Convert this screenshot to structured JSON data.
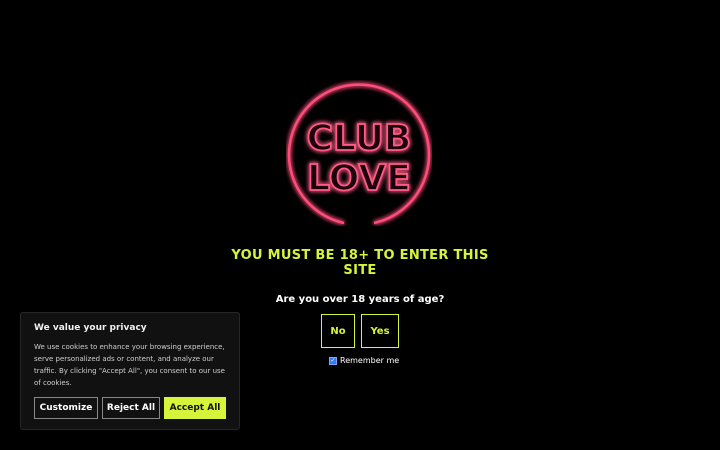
{
  "logo": {
    "line1": "CLUB",
    "line2": "LOVE"
  },
  "gate": {
    "headline": "YOU MUST BE 18+ TO ENTER THIS SITE",
    "question": "Are you over 18 years of age?",
    "no_label": "No",
    "yes_label": "Yes",
    "remember_label": "Remember me",
    "remember_checked": true
  },
  "cookie_banner": {
    "title": "We value your privacy",
    "text": "We use cookies to enhance your browsing experience, serve personalized ads or content, and analyze our traffic. By clicking \"Accept All\", you consent to our use of cookies.",
    "customize_label": "Customize",
    "reject_label": "Reject All",
    "accept_label": "Accept All"
  },
  "colors": {
    "accent": "#d6f53a",
    "neon": "#ff3d6e",
    "background": "#000000"
  }
}
